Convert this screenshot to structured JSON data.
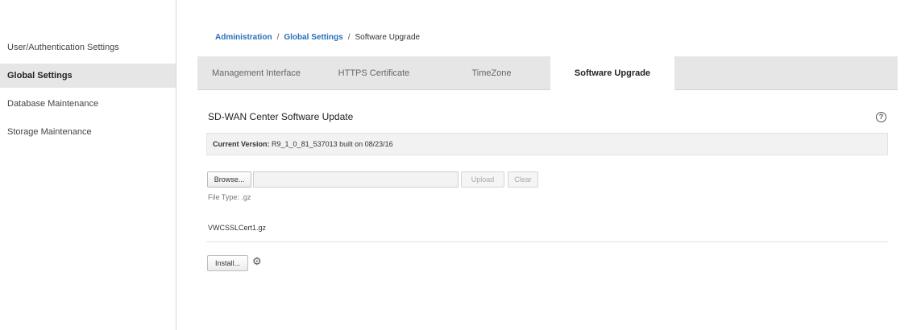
{
  "sidebar": {
    "items": [
      {
        "label": "User/Authentication Settings"
      },
      {
        "label": "Global Settings"
      },
      {
        "label": "Database Maintenance"
      },
      {
        "label": "Storage Maintenance"
      }
    ]
  },
  "breadcrumb": {
    "items": [
      "Administration",
      "Global Settings",
      "Software Upgrade"
    ],
    "separator": "/"
  },
  "tabs": [
    {
      "label": "Management Interface"
    },
    {
      "label": "HTTPS Certificate"
    },
    {
      "label": "TimeZone"
    },
    {
      "label": "Software Upgrade"
    }
  ],
  "section": {
    "title": "SD-WAN Center Software Update",
    "help_icon": "question-circle-icon"
  },
  "version": {
    "label": "Current Version:",
    "value": "R9_1_0_81_537013 built on 08/23/16"
  },
  "upload": {
    "browse_label": "Browse...",
    "file_value": "",
    "upload_label": "Upload",
    "clear_label": "Clear",
    "file_type": "File Type: .gz"
  },
  "selected_file": "VWCSSLCert1.gz",
  "install": {
    "label": "Install...",
    "icon": "gear-icon"
  },
  "colors": {
    "link": "#2a6ebb",
    "active_nav_bg": "#e6e6e6",
    "tab_bar_bg": "#e6e6e6"
  }
}
